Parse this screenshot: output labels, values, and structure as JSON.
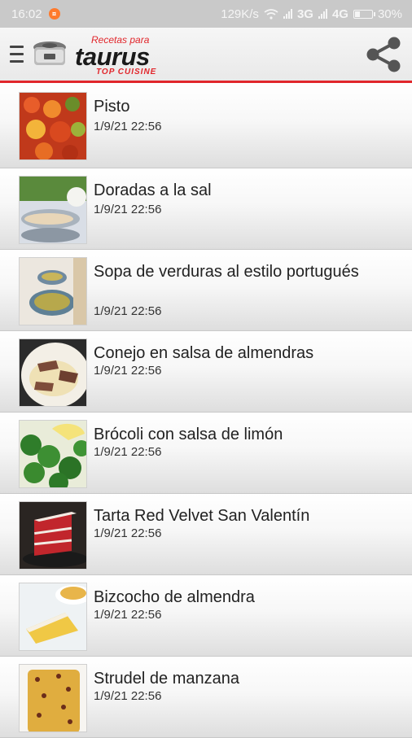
{
  "status_bar": {
    "time": "16:02",
    "network_speed": "129K/s",
    "net1": "3G",
    "net2": "4G",
    "battery": "30%"
  },
  "app_bar": {
    "logo_top": "Recetas para",
    "logo_brand": "taurus",
    "logo_sub": "TOP CUISINE",
    "accent_color": "#e1262b"
  },
  "recipes": [
    {
      "title": "Pisto",
      "date": "1/9/21 22:56",
      "icon": "pisto-thumbnail"
    },
    {
      "title": "Doradas a la sal",
      "date": "1/9/21 22:56",
      "icon": "doradas-thumbnail"
    },
    {
      "title": "Sopa de verduras al estilo portugués",
      "date": "1/9/21 22:56",
      "icon": "sopa-thumbnail"
    },
    {
      "title": "Conejo en salsa de almendras",
      "date": "1/9/21 22:56",
      "icon": "conejo-thumbnail"
    },
    {
      "title": "Brócoli con salsa de limón",
      "date": "1/9/21 22:56",
      "icon": "brocoli-thumbnail"
    },
    {
      "title": "Tarta Red Velvet San Valentín",
      "date": "1/9/21 22:56",
      "icon": "tarta-thumbnail"
    },
    {
      "title": "Bizcocho de almendra",
      "date": "1/9/21 22:56",
      "icon": "bizcocho-thumbnail"
    },
    {
      "title": "Strudel de manzana",
      "date": "1/9/21 22:56",
      "icon": "strudel-thumbnail"
    }
  ]
}
